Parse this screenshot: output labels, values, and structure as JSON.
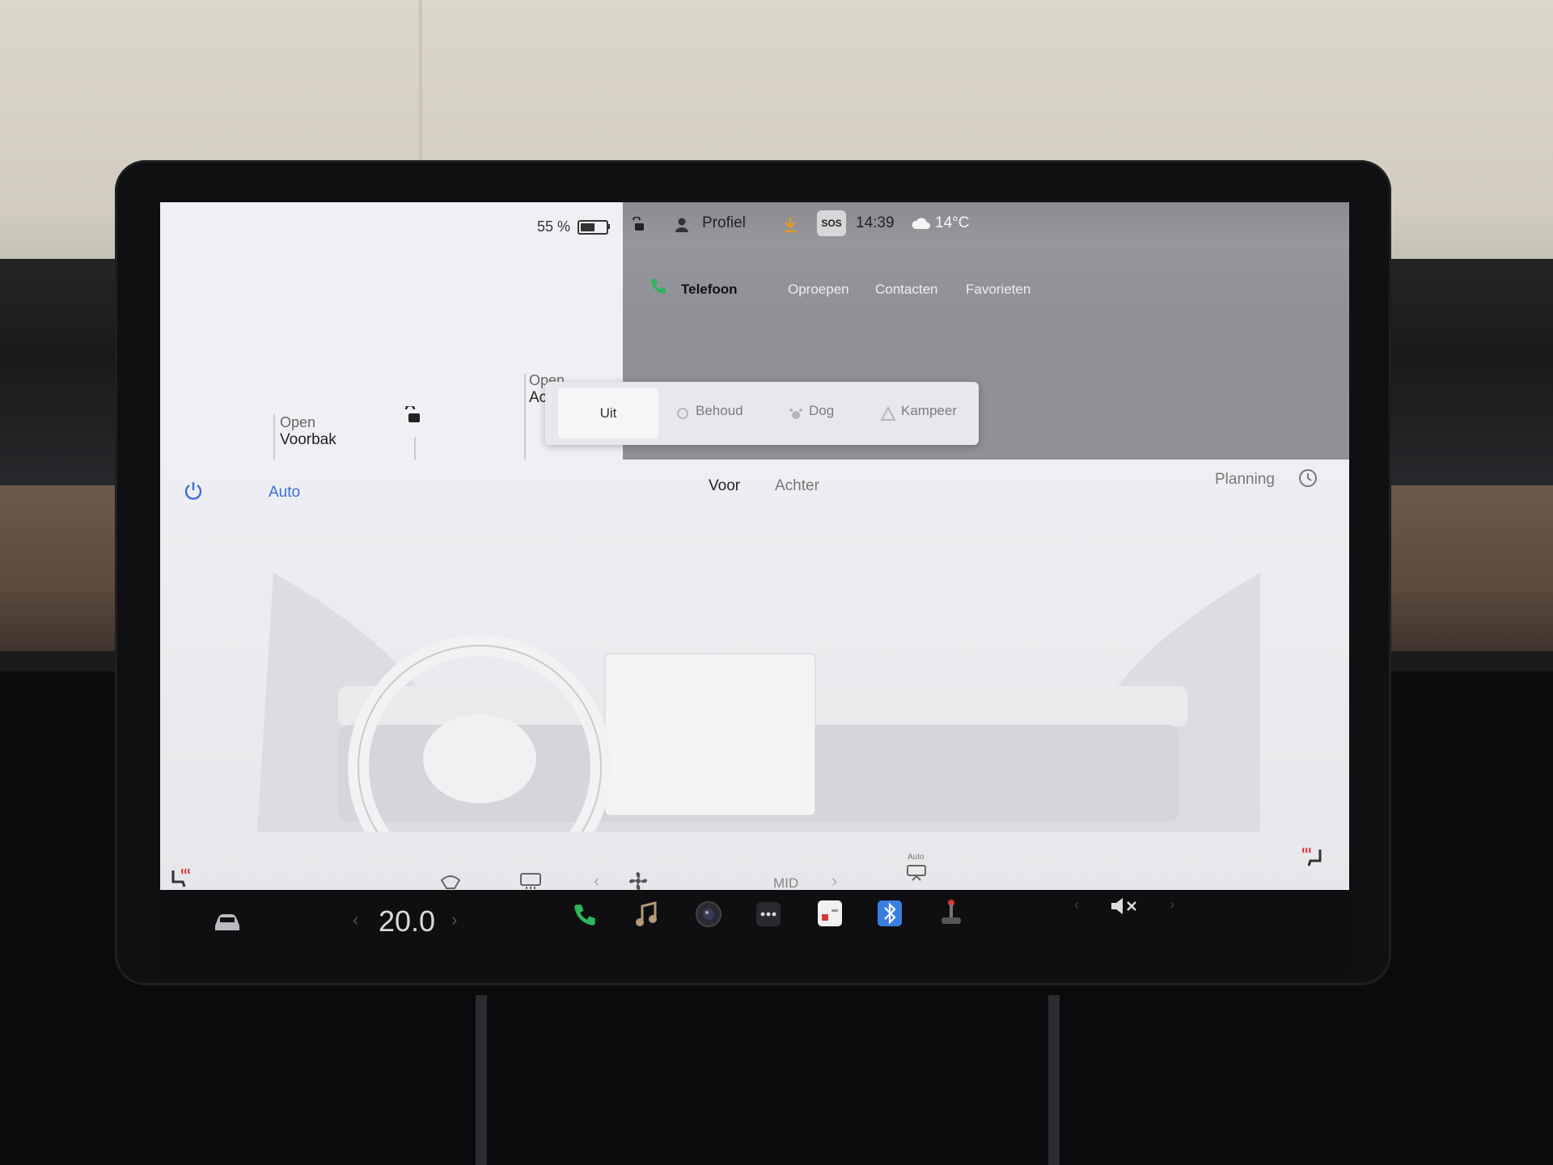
{
  "status_bar": {
    "battery_percent": "55 %",
    "battery_level": 0.55,
    "profile_label": "Profiel",
    "sos_label": "SOS",
    "time": "14:39",
    "outside_temp": "14°C"
  },
  "trunk_controls": {
    "front_open_label": "Open",
    "front_name": "Voorbak",
    "rear_open_label": "Open",
    "rear_name_partial": "Ac"
  },
  "phone": {
    "tabs": [
      "Telefoon",
      "Oproepen",
      "Contacten",
      "Favorieten"
    ]
  },
  "climate_keeper": {
    "options": [
      "Uit",
      "Behoud",
      "Dog",
      "Kampeer"
    ],
    "selected": "Uit"
  },
  "climate": {
    "mode_label": "Auto",
    "front_label": "Voor",
    "rear_label": "Achter",
    "planning_label": "Planning",
    "fan_level": "MID",
    "auto_small_label": "Auto"
  },
  "taskbar": {
    "temperature": "20.0"
  },
  "colors": {
    "accent_blue": "#3a6fd8",
    "phone_green": "#2fb55a",
    "download_orange": "#e39b2a",
    "heat_red": "#d83a3a"
  }
}
